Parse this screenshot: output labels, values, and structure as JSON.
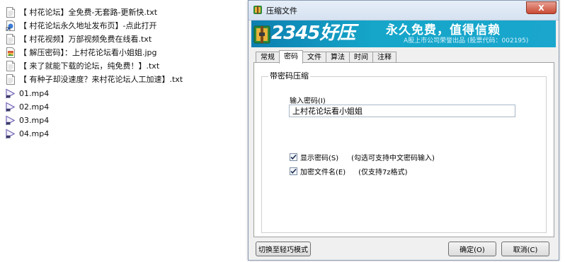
{
  "files": [
    {
      "name": "【 村花论坛】全免费-无套路-更新快.txt",
      "icon": "text-file-icon"
    },
    {
      "name": "【 村花论坛永久地址发布页】-点此打开",
      "icon": "link-shortcut-icon"
    },
    {
      "name": "【 村花视频】万部视频免费在线看.txt",
      "icon": "text-file-icon"
    },
    {
      "name": "【 解压密码】：上村花论坛看小姐姐.jpg",
      "icon": "image-file-icon"
    },
    {
      "name": "【 来了就能下载的论坛，纯免费！】.txt",
      "icon": "text-file-icon"
    },
    {
      "name": "【 有种子却没速度？来村花论坛人工加速】.txt",
      "icon": "text-file-icon"
    },
    {
      "name": "01.mp4",
      "icon": "video-file-icon"
    },
    {
      "name": "02.mp4",
      "icon": "video-file-icon"
    },
    {
      "name": "03.mp4",
      "icon": "video-file-icon"
    },
    {
      "name": "04.mp4",
      "icon": "video-file-icon"
    }
  ],
  "dialog": {
    "title": "压缩文件",
    "close_label": "X",
    "banner": {
      "brand": "2345好压",
      "slogan": "永久免费，值得信赖",
      "subtitle": "A股上市公司荣誉出品 (股票代码：002195)"
    },
    "tabs": [
      {
        "label": "常规",
        "active": false
      },
      {
        "label": "密码",
        "active": true
      },
      {
        "label": "文件",
        "active": false
      },
      {
        "label": "算法",
        "active": false
      },
      {
        "label": "时间",
        "active": false
      },
      {
        "label": "注释",
        "active": false
      }
    ],
    "group_title": "带密码压缩",
    "password_label": "输入密码(I)",
    "password_value": "上村花论坛看小姐姐",
    "show_password": {
      "label": "显示密码(S)",
      "checked": true,
      "note": "(勾选可支持中文密码输入)"
    },
    "encrypt_names": {
      "label": "加密文件名(E)",
      "checked": true,
      "note": "(仅支持7z格式)"
    },
    "buttons": {
      "switch_mode": "切换至轻巧模式",
      "ok": "确定(O)",
      "cancel": "取消(C)"
    }
  },
  "colors": {
    "banner": "#15a6c9",
    "close_button": "#c94a34"
  }
}
